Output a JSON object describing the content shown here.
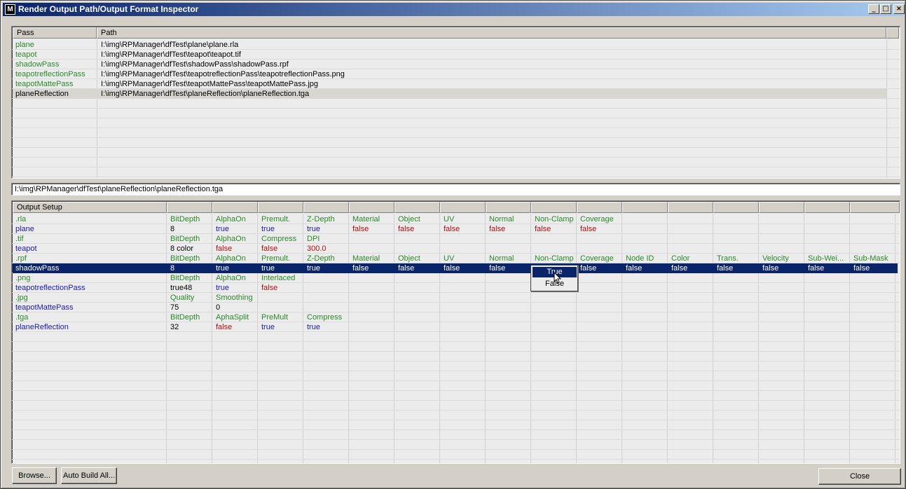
{
  "window": {
    "title": "Render Output Path/Output Format Inspector",
    "app_icon": "3ds-max-icon",
    "controls": {
      "minimize": "_",
      "maximize": "□",
      "close": "×"
    }
  },
  "passes_table": {
    "columns": [
      "Pass",
      "Path"
    ],
    "rows": [
      {
        "pass": "plane",
        "path": "I:\\img\\RPManager\\dfTest\\plane\\plane.rla"
      },
      {
        "pass": "teapot",
        "path": "I:\\img\\RPManager\\dfTest\\teapot\\teapot.tif"
      },
      {
        "pass": "shadowPass",
        "path": "I:\\img\\RPManager\\dfTest\\shadowPass\\shadowPass.rpf"
      },
      {
        "pass": "teapotreflectionPass",
        "path": "I:\\img\\RPManager\\dfTest\\teapotreflectionPass\\teapotreflectionPass.png"
      },
      {
        "pass": "teapotMattePass",
        "path": "I:\\img\\RPManager\\dfTest\\teapotMattePass\\teapotMattePass.jpg"
      },
      {
        "pass": "planeReflection",
        "path": "I:\\img\\RPManager\\dfTest\\planeReflection\\planeReflection.tga"
      }
    ],
    "selected_index": 5
  },
  "selected_path": "I:\\img\\RPManager\\dfTest\\planeReflection\\planeReflection.tga",
  "output_table": {
    "header": "Output Setup",
    "rows": [
      {
        "kind": "format",
        "name": ".rla",
        "cells": [
          "BitDepth",
          "AlphaOn",
          "Premult.",
          "Z-Depth",
          "Material",
          "Object",
          "UV",
          "Normal",
          "Non-Clamp",
          "Coverage"
        ]
      },
      {
        "kind": "pass",
        "name": "plane",
        "cells": [
          "8",
          "true",
          "true",
          "true",
          "false",
          "false",
          "false",
          "false",
          "false",
          "false"
        ]
      },
      {
        "kind": "format",
        "name": ".tif",
        "cells": [
          "BitDepth",
          "AlphaOn",
          "Compress",
          "DPI"
        ]
      },
      {
        "kind": "pass",
        "name": "teapot",
        "cells": [
          "8 color",
          "false",
          "false",
          "300.0"
        ]
      },
      {
        "kind": "format",
        "name": ".rpf",
        "cells": [
          "BitDepth",
          "AlphaOn",
          "Premult.",
          "Z-Depth",
          "Material",
          "Object",
          "UV",
          "Normal",
          "Non-Clamp",
          "Coverage",
          "Node ID",
          "Color",
          "Trans.",
          "Velocity",
          "Sub-Wei...",
          "Sub-Mask"
        ]
      },
      {
        "kind": "pass",
        "name": "shadowPass",
        "selected": true,
        "cells": [
          "8",
          "true",
          "true",
          "true",
          "false",
          "false",
          "false",
          "false",
          "",
          "false",
          "false",
          "false",
          "false",
          "false",
          "false",
          "false"
        ]
      },
      {
        "kind": "format",
        "name": ".png",
        "cells": [
          "BitDepth",
          "AlphaOn",
          "Interlaced"
        ]
      },
      {
        "kind": "pass",
        "name": "teapotreflectionPass",
        "cells": [
          "true48",
          "true",
          "false"
        ]
      },
      {
        "kind": "format",
        "name": ".jpg",
        "cells": [
          "Quality",
          "Smoothing"
        ]
      },
      {
        "kind": "pass",
        "name": "teapotMattePass",
        "cells": [
          "75",
          "0"
        ]
      },
      {
        "kind": "format",
        "name": ".tga",
        "cells": [
          "BitDepth",
          "AphaSplit",
          "PreMult",
          "Compress"
        ]
      },
      {
        "kind": "pass",
        "name": "planeReflection",
        "cells": [
          "32",
          "false",
          "true",
          "true"
        ]
      }
    ]
  },
  "dropdown": {
    "options": [
      "True",
      "False"
    ],
    "highlighted": "True"
  },
  "buttons": {
    "browse": "Browse...",
    "auto_build": "Auto Build All...",
    "close": "Close"
  },
  "colors": {
    "title_gradient_start": "#0a246a",
    "title_gradient_end": "#a6caf0",
    "format_text": "#2a8a2a",
    "true_text": "#1a1ab0",
    "false_text": "#b41010",
    "selection": "#0a246a"
  }
}
